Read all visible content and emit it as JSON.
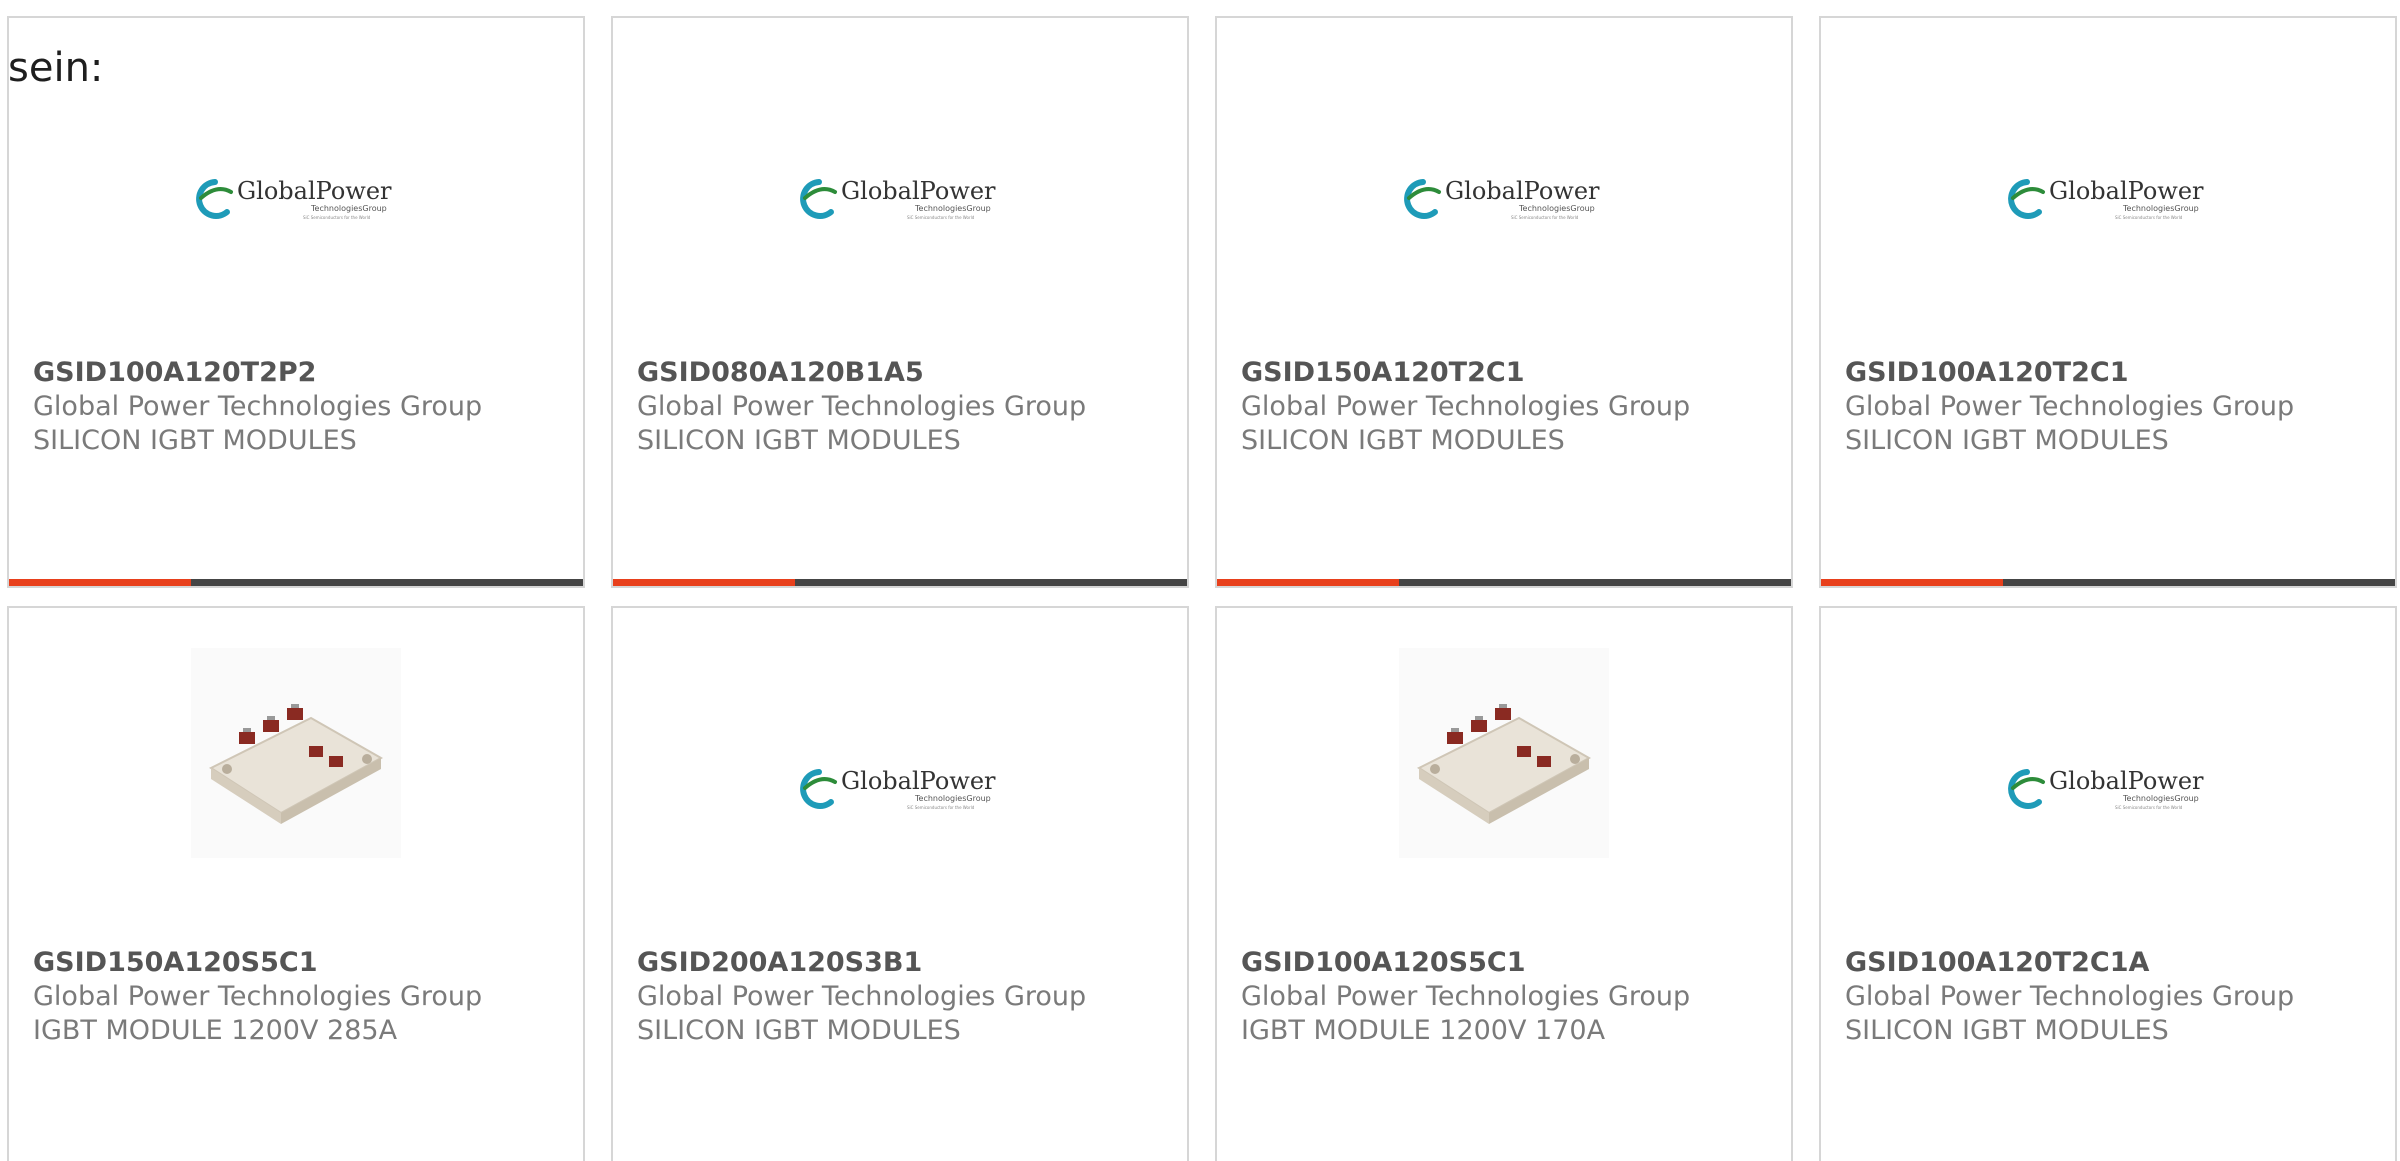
{
  "intro_text": "sein:",
  "colors": {
    "accent": "#e8401c",
    "bar": "#454545",
    "border": "#d6d6d6",
    "part_number": "#555555",
    "secondary_text": "#7a7a7a",
    "logo_teal": "#1e9bb8",
    "logo_green": "#2d8c3a"
  },
  "brand_logo": {
    "name": "GlobalPower",
    "sub": "TechnologiesGroup",
    "tagline": "SiC Semiconductors for the World"
  },
  "products": [
    {
      "part_number": "GSID100A120T2P2",
      "manufacturer": "Global Power Technologies Group",
      "description": "SILICON IGBT MODULES",
      "image": "globalpower-logo"
    },
    {
      "part_number": "GSID080A120B1A5",
      "manufacturer": "Global Power Technologies Group",
      "description": "SILICON IGBT MODULES",
      "image": "globalpower-logo"
    },
    {
      "part_number": "GSID150A120T2C1",
      "manufacturer": "Global Power Technologies Group",
      "description": "SILICON IGBT MODULES",
      "image": "globalpower-logo"
    },
    {
      "part_number": "GSID100A120T2C1",
      "manufacturer": "Global Power Technologies Group",
      "description": "SILICON IGBT MODULES",
      "image": "globalpower-logo"
    },
    {
      "part_number": "GSID150A120S5C1",
      "manufacturer": "Global Power Technologies Group",
      "description": "IGBT MODULE 1200V 285A",
      "image": "igbt-module-photo"
    },
    {
      "part_number": "GSID200A120S3B1",
      "manufacturer": "Global Power Technologies Group",
      "description": "SILICON IGBT MODULES",
      "image": "globalpower-logo"
    },
    {
      "part_number": "GSID100A120S5C1",
      "manufacturer": "Global Power Technologies Group",
      "description": "IGBT MODULE 1200V 170A",
      "image": "igbt-module-photo"
    },
    {
      "part_number": "GSID100A120T2C1A",
      "manufacturer": "Global Power Technologies Group",
      "description": "SILICON IGBT MODULES",
      "image": "globalpower-logo"
    }
  ]
}
